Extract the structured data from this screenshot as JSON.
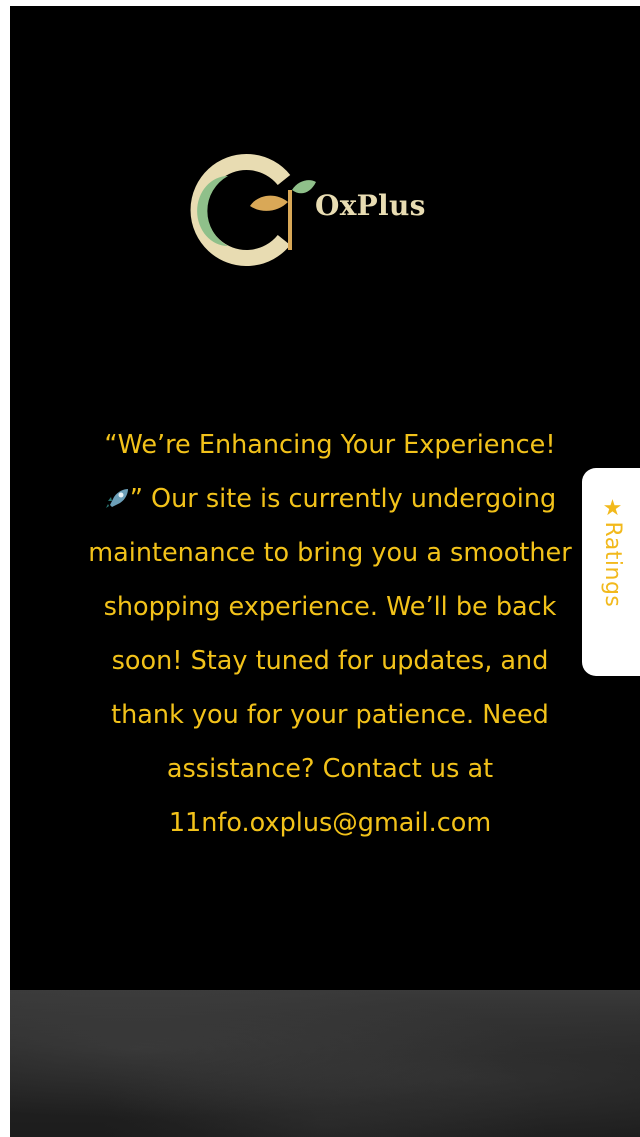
{
  "brand": {
    "name": "OxPlus",
    "logo_colors": {
      "ring": "#e8dcb2",
      "leaf_green": "#8fc08a",
      "leaf_gold": "#d9a857"
    }
  },
  "message": {
    "line_1": "“We’re Enhancing Your Experience!",
    "rocket_icon": "rocket-icon",
    "line_2_rest": "” Our site is currently undergoing",
    "line_3": "maintenance to bring you a smoother",
    "line_4": "shopping experience. We’ll be back",
    "line_5": "soon! Stay tuned for updates, and",
    "line_6": "thank you for your patience. Need",
    "line_7": "assistance? Contact us at",
    "email": "11nfo.oxplus@gmail.com"
  },
  "ratings_tab": {
    "icon": "star-icon",
    "label": "★Ratings"
  },
  "colors": {
    "background": "#000000",
    "message_text": "#f2c21a",
    "tab_text": "#f2b91c",
    "tab_background": "#ffffff"
  }
}
